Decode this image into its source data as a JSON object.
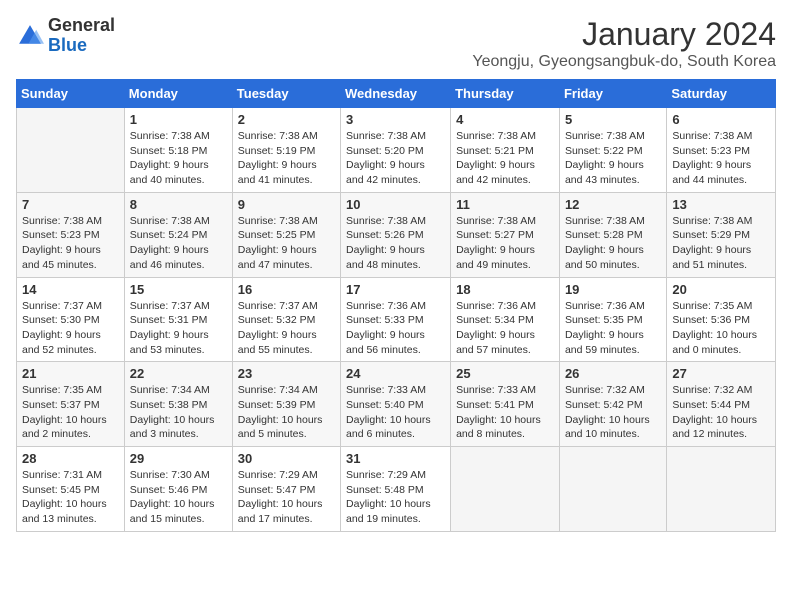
{
  "header": {
    "logo": {
      "general": "General",
      "blue": "Blue"
    },
    "title": "January 2024",
    "location": "Yeongju, Gyeongsangbuk-do, South Korea"
  },
  "calendar": {
    "days_of_week": [
      "Sunday",
      "Monday",
      "Tuesday",
      "Wednesday",
      "Thursday",
      "Friday",
      "Saturday"
    ],
    "weeks": [
      [
        {
          "day": "",
          "info": ""
        },
        {
          "day": "1",
          "info": "Sunrise: 7:38 AM\nSunset: 5:18 PM\nDaylight: 9 hours\nand 40 minutes."
        },
        {
          "day": "2",
          "info": "Sunrise: 7:38 AM\nSunset: 5:19 PM\nDaylight: 9 hours\nand 41 minutes."
        },
        {
          "day": "3",
          "info": "Sunrise: 7:38 AM\nSunset: 5:20 PM\nDaylight: 9 hours\nand 42 minutes."
        },
        {
          "day": "4",
          "info": "Sunrise: 7:38 AM\nSunset: 5:21 PM\nDaylight: 9 hours\nand 42 minutes."
        },
        {
          "day": "5",
          "info": "Sunrise: 7:38 AM\nSunset: 5:22 PM\nDaylight: 9 hours\nand 43 minutes."
        },
        {
          "day": "6",
          "info": "Sunrise: 7:38 AM\nSunset: 5:23 PM\nDaylight: 9 hours\nand 44 minutes."
        }
      ],
      [
        {
          "day": "7",
          "info": "Sunrise: 7:38 AM\nSunset: 5:23 PM\nDaylight: 9 hours\nand 45 minutes."
        },
        {
          "day": "8",
          "info": "Sunrise: 7:38 AM\nSunset: 5:24 PM\nDaylight: 9 hours\nand 46 minutes."
        },
        {
          "day": "9",
          "info": "Sunrise: 7:38 AM\nSunset: 5:25 PM\nDaylight: 9 hours\nand 47 minutes."
        },
        {
          "day": "10",
          "info": "Sunrise: 7:38 AM\nSunset: 5:26 PM\nDaylight: 9 hours\nand 48 minutes."
        },
        {
          "day": "11",
          "info": "Sunrise: 7:38 AM\nSunset: 5:27 PM\nDaylight: 9 hours\nand 49 minutes."
        },
        {
          "day": "12",
          "info": "Sunrise: 7:38 AM\nSunset: 5:28 PM\nDaylight: 9 hours\nand 50 minutes."
        },
        {
          "day": "13",
          "info": "Sunrise: 7:38 AM\nSunset: 5:29 PM\nDaylight: 9 hours\nand 51 minutes."
        }
      ],
      [
        {
          "day": "14",
          "info": "Sunrise: 7:37 AM\nSunset: 5:30 PM\nDaylight: 9 hours\nand 52 minutes."
        },
        {
          "day": "15",
          "info": "Sunrise: 7:37 AM\nSunset: 5:31 PM\nDaylight: 9 hours\nand 53 minutes."
        },
        {
          "day": "16",
          "info": "Sunrise: 7:37 AM\nSunset: 5:32 PM\nDaylight: 9 hours\nand 55 minutes."
        },
        {
          "day": "17",
          "info": "Sunrise: 7:36 AM\nSunset: 5:33 PM\nDaylight: 9 hours\nand 56 minutes."
        },
        {
          "day": "18",
          "info": "Sunrise: 7:36 AM\nSunset: 5:34 PM\nDaylight: 9 hours\nand 57 minutes."
        },
        {
          "day": "19",
          "info": "Sunrise: 7:36 AM\nSunset: 5:35 PM\nDaylight: 9 hours\nand 59 minutes."
        },
        {
          "day": "20",
          "info": "Sunrise: 7:35 AM\nSunset: 5:36 PM\nDaylight: 10 hours\nand 0 minutes."
        }
      ],
      [
        {
          "day": "21",
          "info": "Sunrise: 7:35 AM\nSunset: 5:37 PM\nDaylight: 10 hours\nand 2 minutes."
        },
        {
          "day": "22",
          "info": "Sunrise: 7:34 AM\nSunset: 5:38 PM\nDaylight: 10 hours\nand 3 minutes."
        },
        {
          "day": "23",
          "info": "Sunrise: 7:34 AM\nSunset: 5:39 PM\nDaylight: 10 hours\nand 5 minutes."
        },
        {
          "day": "24",
          "info": "Sunrise: 7:33 AM\nSunset: 5:40 PM\nDaylight: 10 hours\nand 6 minutes."
        },
        {
          "day": "25",
          "info": "Sunrise: 7:33 AM\nSunset: 5:41 PM\nDaylight: 10 hours\nand 8 minutes."
        },
        {
          "day": "26",
          "info": "Sunrise: 7:32 AM\nSunset: 5:42 PM\nDaylight: 10 hours\nand 10 minutes."
        },
        {
          "day": "27",
          "info": "Sunrise: 7:32 AM\nSunset: 5:44 PM\nDaylight: 10 hours\nand 12 minutes."
        }
      ],
      [
        {
          "day": "28",
          "info": "Sunrise: 7:31 AM\nSunset: 5:45 PM\nDaylight: 10 hours\nand 13 minutes."
        },
        {
          "day": "29",
          "info": "Sunrise: 7:30 AM\nSunset: 5:46 PM\nDaylight: 10 hours\nand 15 minutes."
        },
        {
          "day": "30",
          "info": "Sunrise: 7:29 AM\nSunset: 5:47 PM\nDaylight: 10 hours\nand 17 minutes."
        },
        {
          "day": "31",
          "info": "Sunrise: 7:29 AM\nSunset: 5:48 PM\nDaylight: 10 hours\nand 19 minutes."
        },
        {
          "day": "",
          "info": ""
        },
        {
          "day": "",
          "info": ""
        },
        {
          "day": "",
          "info": ""
        }
      ]
    ]
  }
}
